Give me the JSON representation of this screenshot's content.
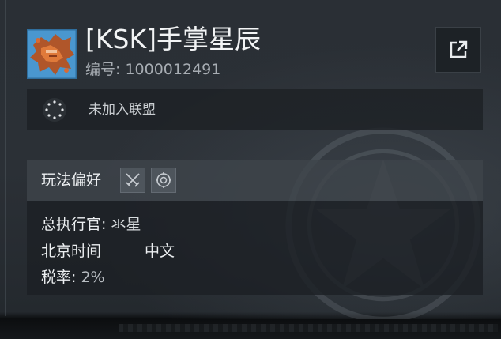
{
  "header": {
    "title": "[KSK]手掌星辰",
    "id_label": "编号: ",
    "id_value": "1000012491"
  },
  "icons": {
    "avatar": "avatar-image",
    "share": "external-link-icon",
    "alliance": "alliance-ring-icon",
    "playstyle_1": "crossed-swords-icon",
    "playstyle_2": "gear-target-icon"
  },
  "alliance": {
    "status": "未加入联盟"
  },
  "playstyle": {
    "label": "玩法偏好"
  },
  "info": {
    "commander_label": "总执行官: ",
    "commander_value": "氺星",
    "timezone": "北京时间",
    "language": "中文",
    "tax_label": "税率: ",
    "tax_value": "2%"
  },
  "colors": {
    "panel_dark": "#1c2024",
    "panel_header": "#3e444b",
    "text_primary": "#eceff1",
    "text_secondary": "#a7adb3"
  }
}
